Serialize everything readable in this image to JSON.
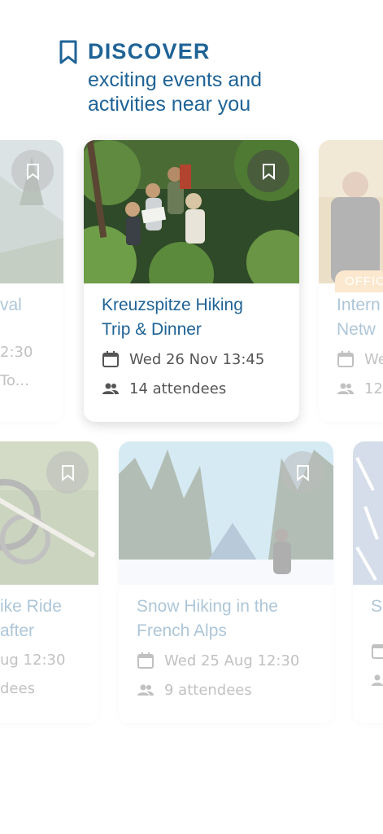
{
  "header": {
    "title": "DISCOVER",
    "subtitle_line1": "exciting events and",
    "subtitle_line2": "activities near you"
  },
  "colors": {
    "accent": "#1f6396",
    "badge": "#f6c07a"
  },
  "row1": [
    {
      "title": "val",
      "date": "2:30",
      "attendees": "To...",
      "state": "faded"
    },
    {
      "title_line1": "Kreuzspitze Hiking",
      "title_line2": "Trip & Dinner",
      "date": "Wed 26 Nov 13:45",
      "attendees": "14 attendees",
      "state": "active"
    },
    {
      "badge": "OFFIC",
      "title_line1": "Intern",
      "title_line2": "Netw",
      "date": "We",
      "attendees": "12",
      "state": "faded"
    }
  ],
  "row2": [
    {
      "title_line1": "ike Ride",
      "title_line2": "after",
      "date": "ug 12:30",
      "attendees": "dees",
      "state": "faded"
    },
    {
      "title_line1": "Snow Hiking in the",
      "title_line2": "French Alps",
      "date": "Wed 25 Aug 12:30",
      "attendees": "9 attendees",
      "state": "faded"
    },
    {
      "title_line1": "S",
      "title_line2": "",
      "date": "",
      "attendees": "",
      "state": "faded"
    }
  ],
  "icons": {
    "save": "bookmark-icon",
    "date": "calendar-icon",
    "people": "people-icon"
  }
}
